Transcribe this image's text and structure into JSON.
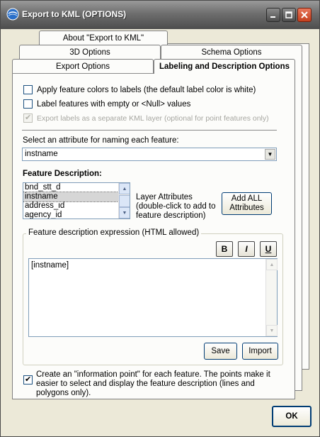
{
  "window": {
    "title": "Export to KML (OPTIONS)",
    "icon": "globe-icon",
    "minimize_icon": "minimize-icon",
    "maximize_icon": "maximize-icon",
    "close_icon": "close-icon",
    "title_bar_color": "#6e6e6e",
    "close_color": "#d4532d"
  },
  "tabs": {
    "row1": [
      "About \"Export to KML\""
    ],
    "row2": [
      "3D Options",
      "Schema Options"
    ],
    "row3": [
      "Export Options",
      "Labeling and Description Options"
    ],
    "active": "Labeling and Description Options"
  },
  "labeling": {
    "apply_colors": {
      "label": "Apply feature colors to labels (the default label color is white)",
      "checked": false
    },
    "label_empty": {
      "label": "Label features with empty or <Null> values",
      "checked": false
    },
    "separate_layer": {
      "label": "Export labels as a separate KML layer (optional for point features only)",
      "checked": true,
      "enabled": false
    }
  },
  "naming": {
    "label": "Select an attribute for naming each feature:",
    "value": "instname"
  },
  "description": {
    "heading": "Feature Description:",
    "attributes": [
      "bnd_stt_d",
      "instname",
      "address_id",
      "agency_id"
    ],
    "selected": "instname",
    "hint": "Layer Attributes (double-click to add to feature description)",
    "add_all_label": "Add ALL Attributes",
    "expression_label": "Feature description expression (HTML allowed)",
    "bold_label": "B",
    "italic_label": "I",
    "underline_label": "U",
    "expression_value": "[instname]",
    "save_label": "Save",
    "import_label": "Import"
  },
  "info_point": {
    "label": "Create an \"information point\" for each feature. The points make it easier to select and display the feature description (lines and polygons only).",
    "checked": true
  },
  "footer": {
    "ok_label": "OK"
  }
}
